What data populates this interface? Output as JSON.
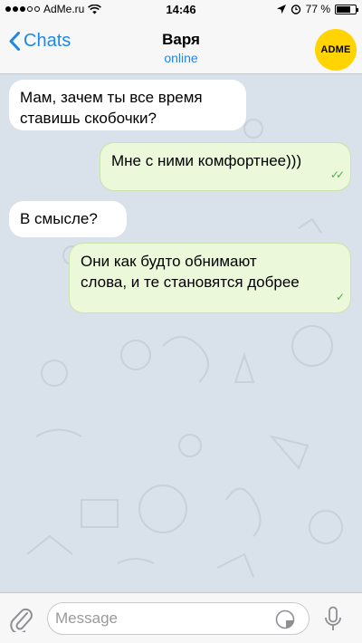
{
  "status_bar": {
    "carrier": "AdMe.ru",
    "time": "14:46",
    "battery": "77 %",
    "battery_level": 0.77
  },
  "header": {
    "back_label": "Chats",
    "contact_name": "Варя",
    "contact_status": "online",
    "avatar_text": "ADME"
  },
  "messages": [
    {
      "direction": "incoming",
      "lines": [
        "Мам, зачем ты все время",
        "ставишь скобочки?"
      ]
    },
    {
      "direction": "outgoing",
      "lines": [
        "Мне с ними комфортнее)))"
      ],
      "status": "read"
    },
    {
      "direction": "incoming",
      "lines": [
        "В смысле?"
      ]
    },
    {
      "direction": "outgoing",
      "lines": [
        "Они как будто обнимают",
        "слова, и те становятся добрее"
      ],
      "status": "sent"
    }
  ],
  "composer": {
    "placeholder": "Message"
  },
  "colors": {
    "accent": "#1f87e6",
    "chat_background": "#d9e2ea",
    "outgoing_bubble": "#ebf8d9",
    "avatar": "#ffd400",
    "check": "#4cb04a"
  }
}
